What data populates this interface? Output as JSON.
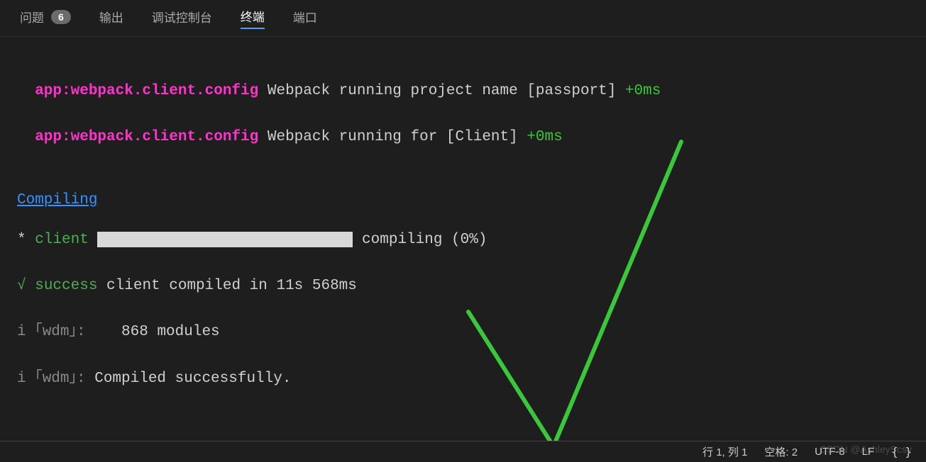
{
  "tabs": {
    "problems": "问题",
    "problems_count": "6",
    "output": "输出",
    "debug_console": "调试控制台",
    "terminal": "终端",
    "ports": "端口"
  },
  "terminal": {
    "line1_prefix": "  app:webpack.client.config",
    "line1_body": " Webpack running project name [passport] ",
    "line1_timing": "+0ms",
    "line2_prefix": "  app:webpack.client.config",
    "line2_body": " Webpack running for [Client] ",
    "line2_timing": "+0ms",
    "compiling": "Compiling",
    "star": "*",
    "client_label": " client ",
    "compiling_pct": " compiling (0%)",
    "check": "√",
    "success_label": " success ",
    "compiled_msg": "client compiled in 11s 568ms",
    "wdm1_prefix": "i ｢wdm｣:    ",
    "wdm1_body": "868 modules",
    "wdm2_prefix": "i ｢wdm｣: ",
    "wdm2_body": "Compiled successfully."
  },
  "statusbar": {
    "line_col": "行 1, 列 1",
    "spaces": "空格: 2",
    "encoding": "UTF-8",
    "eol": "LF",
    "lang": "{ }"
  },
  "watermark": "CSDN @AshleyScsy"
}
